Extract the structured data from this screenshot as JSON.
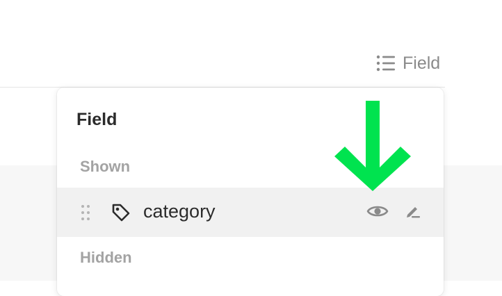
{
  "toolbar": {
    "field_button_label": "Field",
    "field_button_icon": "list-icon"
  },
  "panel": {
    "title": "Field",
    "shown_label": "Shown",
    "hidden_label": "Hidden",
    "shown_fields": [
      {
        "name": "category",
        "type_icon": "tag-icon",
        "visibility_icon": "eye-icon",
        "edit_icon": "pencil-icon"
      }
    ]
  },
  "annotation": {
    "arrow_color": "#00e34f"
  },
  "colors": {
    "row_highlight": "#f1f1f1",
    "muted_text": "#a3a3a3",
    "primary_text": "#2b2b2b"
  }
}
